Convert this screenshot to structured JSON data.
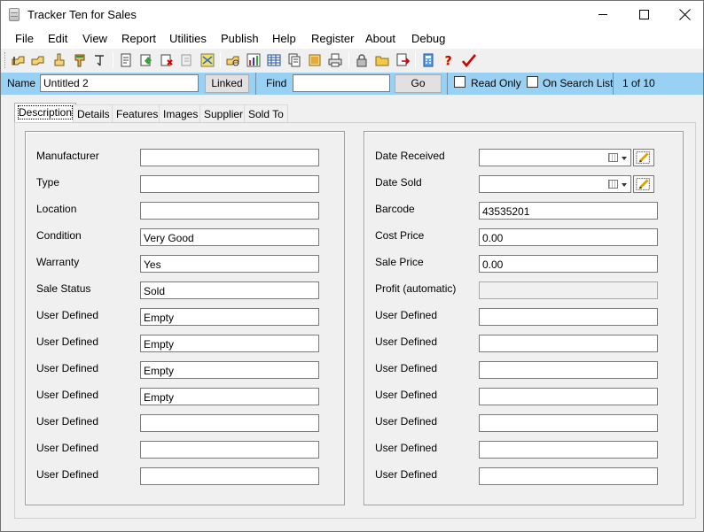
{
  "window": {
    "title": "Tracker Ten for Sales"
  },
  "menu": [
    "File",
    "Edit",
    "View",
    "Report",
    "Utilities",
    "Publish",
    "Help",
    "Register",
    "About",
    "Debug"
  ],
  "findbar": {
    "name_label": "Name",
    "name_value": "Untitled 2",
    "linked_label": "Linked",
    "find_label": "Find",
    "find_value": "",
    "go_label": "Go",
    "read_only_label": "Read Only",
    "on_search_list_label": "On Search List",
    "record_position": "1 of 10"
  },
  "tabs": [
    "Description",
    "Details",
    "Features",
    "Images",
    "Supplier",
    "Sold To"
  ],
  "active_tab": "Description",
  "left_fields": [
    {
      "label": "Manufacturer",
      "value": ""
    },
    {
      "label": "Type",
      "value": ""
    },
    {
      "label": "Location",
      "value": ""
    },
    {
      "label": "Condition",
      "value": "Very Good"
    },
    {
      "label": "Warranty",
      "value": "Yes"
    },
    {
      "label": "Sale Status",
      "value": "Sold"
    },
    {
      "label": "User Defined",
      "value": "Empty"
    },
    {
      "label": "User Defined",
      "value": "Empty"
    },
    {
      "label": "User Defined",
      "value": "Empty"
    },
    {
      "label": "User Defined",
      "value": "Empty"
    },
    {
      "label": "User Defined",
      "value": ""
    },
    {
      "label": "User Defined",
      "value": ""
    },
    {
      "label": "User Defined",
      "value": ""
    }
  ],
  "right_fields": [
    {
      "label": "Date Received",
      "value": ""
    },
    {
      "label": "Date Sold",
      "value": ""
    },
    {
      "label": "Barcode",
      "value": "43535201"
    },
    {
      "label": "Cost Price",
      "value": "0.00"
    },
    {
      "label": "Sale Price",
      "value": "0.00"
    },
    {
      "label": "Profit (automatic)",
      "value": ""
    },
    {
      "label": "User Defined",
      "value": ""
    },
    {
      "label": "User Defined",
      "value": ""
    },
    {
      "label": "User Defined",
      "value": ""
    },
    {
      "label": "User Defined",
      "value": ""
    },
    {
      "label": "User Defined",
      "value": ""
    },
    {
      "label": "User Defined",
      "value": ""
    },
    {
      "label": "User Defined",
      "value": ""
    }
  ],
  "colors": {
    "findbar_bg": "#99d1f4",
    "accent_red": "#d40000"
  }
}
